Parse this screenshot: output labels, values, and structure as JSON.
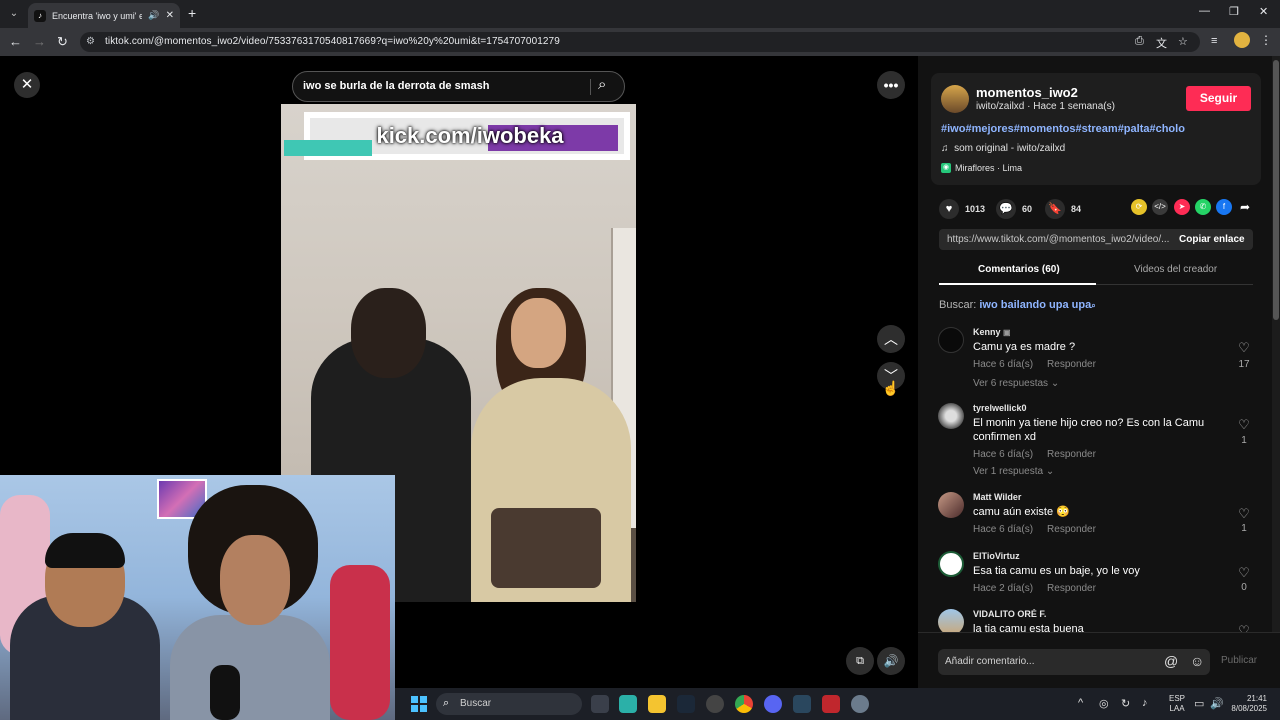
{
  "browser": {
    "tab_title": "Encuentra 'iwo y umi' en Ti",
    "url": "tiktok.com/@momentos_iwo2/video/7533763170540817669?q=iwo%20y%20umi&t=1754707001279"
  },
  "video": {
    "search_text": "iwo se burla de la derrota de smash",
    "banner_text": "kick.com/iwobeka"
  },
  "author": {
    "name": "momentos_iwo2",
    "sub": "iwito/zailxd · Hace 1 semana(s)",
    "follow_label": "Seguir",
    "hashtags": "#iwo#mejores#momentos#stream#palta#cholo",
    "music": "som original - iwito/zailxd",
    "location": "Miraflores · Lima"
  },
  "stats": {
    "likes": "1013",
    "comments": "60",
    "saves": "84"
  },
  "link": {
    "url": "https://www.tiktok.com/@momentos_iwo2/video/...",
    "copy_label": "Copiar enlace"
  },
  "tabs": {
    "comments": "Comentarios (60)",
    "creator_videos": "Videos del creador"
  },
  "search_suggestion": {
    "label": "Buscar:",
    "query": "iwo bailando upa upa"
  },
  "comments": [
    {
      "user": "Kenny",
      "text": "Camu ya es madre ?",
      "time": "Hace 6 día(s)",
      "reply": "Responder",
      "replies": "Ver 6 respuestas",
      "likes": "17"
    },
    {
      "user": "tyrelwellick0",
      "text": "El monin ya tiene hijo creo no? Es con la Camu confirmen xd",
      "time": "Hace 6 día(s)",
      "reply": "Responder",
      "replies": "Ver 1 respuesta",
      "likes": "1"
    },
    {
      "user": "Matt Wilder",
      "text": "camu aún existe 😳",
      "time": "Hace 6 día(s)",
      "reply": "Responder",
      "likes": "1"
    },
    {
      "user": "ElTioVirtuz",
      "text": "Esa tia camu es un baje, yo le voy",
      "time": "Hace 2 día(s)",
      "reply": "Responder",
      "likes": "0"
    },
    {
      "user": "VIDALITO ORÉ F.",
      "text": "la tia camu esta buena"
    }
  ],
  "comment_box": {
    "placeholder": "Añadir comentario...",
    "publish": "Publicar"
  },
  "taskbar": {
    "search": "Buscar",
    "lang1": "ESP",
    "lang2": "LAA",
    "time": "21:41",
    "date": "8/08/2025"
  }
}
